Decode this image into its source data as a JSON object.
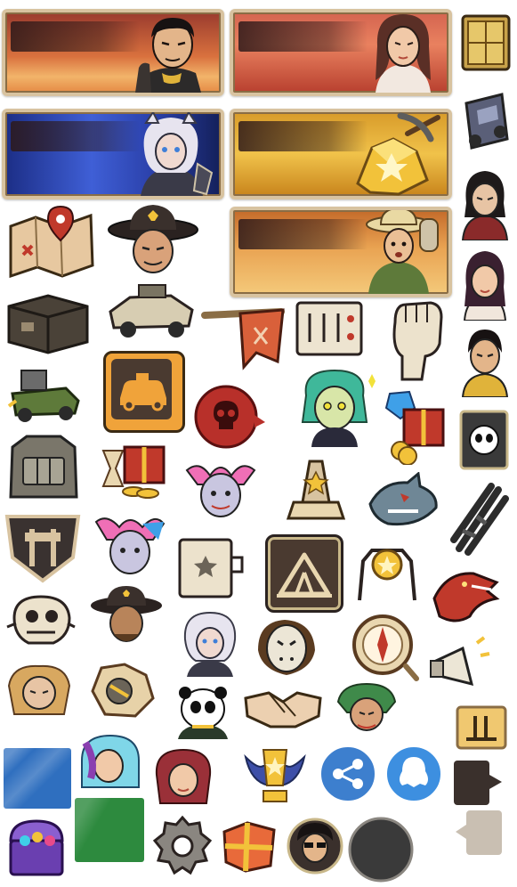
{
  "palette": {
    "parchment": "#e8d5ae",
    "frame": "#d8c3a0",
    "ink": "#2a2220",
    "accent_orange": "#f0a33a",
    "skull_red": "#b8302a",
    "share_blue": "#3d7fce",
    "qq_blue": "#3d8fe0",
    "swatch_blue": "#2f6fbf",
    "swatch_green": "#2d8a3e",
    "bubble_dark": "#3a302c",
    "bubble_light": "#c9bfb2"
  },
  "banners": [
    {
      "name": "banner-desert-hero",
      "theme": "red-desert",
      "icon": "hero-portrait"
    },
    {
      "name": "banner-red-hair-girl",
      "theme": "red-stage",
      "icon": "girl-portrait"
    },
    {
      "name": "banner-white-hair-beast",
      "theme": "blue-night",
      "icon": "beast-portrait"
    },
    {
      "name": "banner-gold-mining",
      "theme": "gold",
      "icon": "pickaxe-gold"
    },
    {
      "name": "banner-explorer",
      "theme": "sand",
      "icon": "explorer-portrait"
    }
  ],
  "icons": [
    "treasure-map-icon",
    "cowboy-sheriff-icon",
    "crate-icon",
    "armored-car-icon",
    "flag-key-icon",
    "control-panel-icon",
    "raised-fist-icon",
    "cannon-truck-icon",
    "taxi-icon",
    "skull-icon",
    "zombie-girl-icon",
    "gems-gift-icon",
    "panda-card-icon",
    "backpack-icon",
    "gift-coins-icon",
    "clown-girl-icon",
    "star-trophy-icon",
    "shark-icon",
    "rifles-icon",
    "shield-emblem-icon",
    "punk-girl-icon",
    "door-card-icon",
    "camp-tent-icon",
    "gold-badge-icon",
    "dragon-icon",
    "grinning-skull-icon",
    "sheriff-bust-icon",
    "beast-bust-icon",
    "hockey-mask-icon",
    "compass-icon",
    "megaphone-icon",
    "blond-man-icon",
    "broken-gear-icon",
    "panda-warrior-icon",
    "handshake-icon",
    "green-goblin-icon",
    "pause-card-icon",
    "blue-swatch-icon",
    "blue-hair-girl-icon",
    "redhead-girl-icon",
    "wing-trophy-icon",
    "share-icon",
    "qq-penguin-icon",
    "dark-bubble-icon",
    "chest-jewels-icon",
    "green-swatch-icon",
    "gear-icon",
    "gift-box-icon",
    "hero-sunglasses-icon",
    "dark-circle-icon",
    "light-bubble-icon"
  ]
}
